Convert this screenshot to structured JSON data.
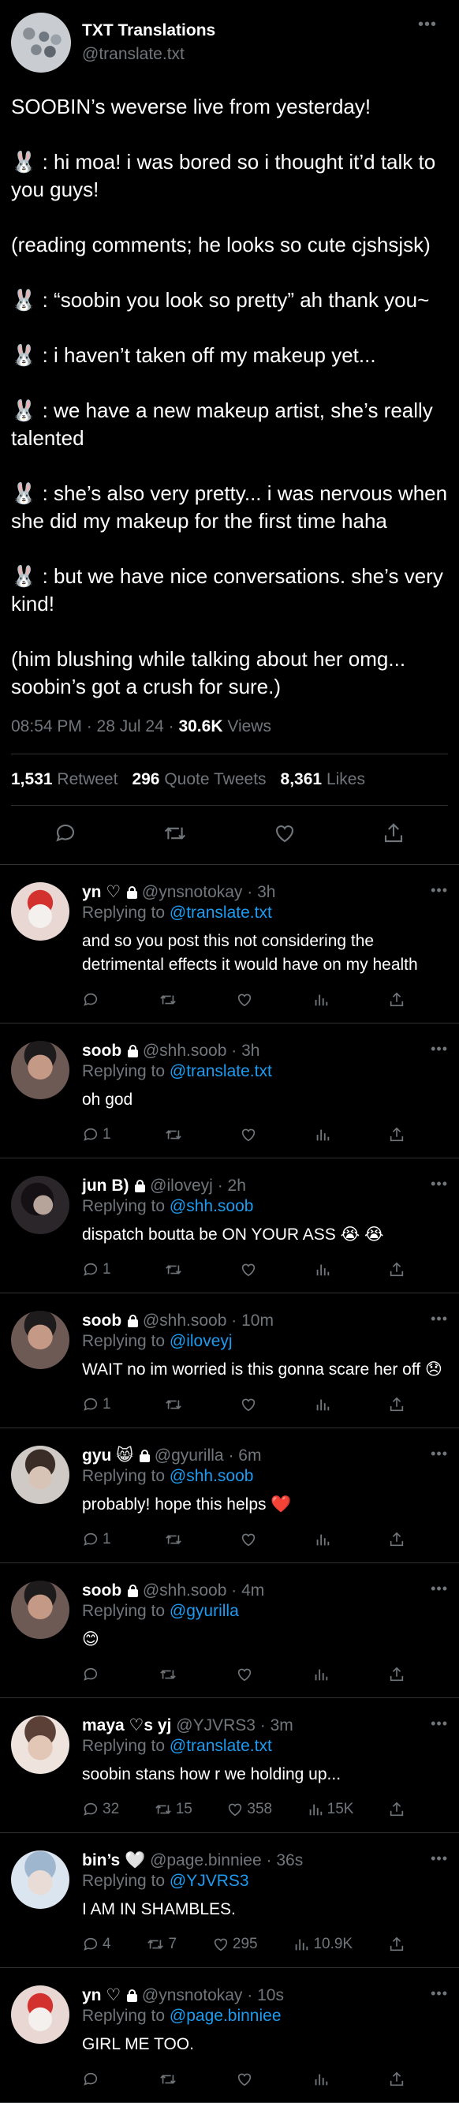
{
  "tweet": {
    "author_name": "TXT Translations",
    "author_handle": "@translate.txt",
    "paragraphs": [
      "SOOBIN’s weverse live from yesterday!",
      "🐰 : hi moa! i was bored so i thought it’d talk to you guys!",
      "(reading comments; he looks so cute cjshsjsk)",
      "🐰 : “soobin you look so pretty” ah thank you~",
      "🐰 : i haven’t taken off my makeup yet...",
      "🐰 : we have a new makeup artist, she’s really talented",
      "🐰 : she’s also very pretty... i was nervous when she did my makeup for the first time haha",
      "🐰 : but we have nice conversations. she’s very kind!",
      "(him blushing while talking about her omg... soobin’s got a crush for sure.)"
    ],
    "time": "08:54 PM · 28 Jul 24 · ",
    "views": "30.6K",
    "views_label": " Views",
    "retweets": "1,531",
    "retweets_label": "Retweet",
    "quotes": "296",
    "quotes_label": "Quote Tweets",
    "likes": "8,361",
    "likes_label": "Likes"
  },
  "replies": [
    {
      "name": "yn",
      "badges": "♡ ",
      "handle": "@ynsnotokay",
      "time": "· 3h",
      "replying_label": "Replying to ",
      "replying_to": "@translate.txt",
      "text": "and so you post this not considering the detrimental effects it would have on my health",
      "replies": "",
      "retweets": "",
      "likes": "",
      "views": ""
    },
    {
      "name": "soob",
      "badges": "",
      "handle": "@shh.soob",
      "time": "· 3h",
      "replying_label": "Replying to ",
      "replying_to": "@translate.txt",
      "text": "oh god",
      "replies": "1",
      "retweets": "",
      "likes": "",
      "views": ""
    },
    {
      "name": "jun B)",
      "badges": "",
      "handle": "@iloveyj",
      "time": "· 2h",
      "replying_label": "Replying to ",
      "replying_to": "@shh.soob",
      "text": "dispatch boutta be ON YOUR ASS 😭 😭",
      "replies": "1",
      "retweets": "",
      "likes": "",
      "views": ""
    },
    {
      "name": "soob",
      "badges": "",
      "handle": "@shh.soob",
      "time": "· 10m",
      "replying_label": "Replying to ",
      "replying_to": "@iloveyj",
      "text": "WAIT no im worried is this gonna scare her off 😞",
      "replies": "1",
      "retweets": "",
      "likes": "",
      "views": ""
    },
    {
      "name": "gyu",
      "badges": "😸 ",
      "handle": "@gyurilla",
      "time": "· 6m",
      "replying_label": "Replying to ",
      "replying_to": "@shh.soob",
      "text": "probably! hope this helps ❤️",
      "replies": "1",
      "retweets": "",
      "likes": "",
      "views": ""
    },
    {
      "name": "soob",
      "badges": "",
      "handle": "@shh.soob",
      "time": "· 4m",
      "replying_label": "Replying to ",
      "replying_to": "@gyurilla",
      "text": "😊",
      "replies": "",
      "retweets": "",
      "likes": "",
      "views": ""
    },
    {
      "name": "maya ♡s yj",
      "badges": "",
      "handle": "@YJVRS3",
      "time": "· 3m",
      "replying_label": "Replying to ",
      "replying_to": "@translate.txt",
      "text": "soobin stans how r we holding up...",
      "replies": "32",
      "retweets": "15",
      "likes": "358",
      "views": "15K"
    },
    {
      "name": "bin’s 🤍",
      "badges": "",
      "handle": "@page.binniee",
      "time": "· 36s",
      "replying_label": "Replying to ",
      "replying_to": "@YJVRS3",
      "text": "I AM IN SHAMBLES.",
      "replies": "4",
      "retweets": "7",
      "likes": "295",
      "views": "10.9K"
    },
    {
      "name": "yn",
      "badges": "♡ ",
      "handle": "@ynsnotokay",
      "time": "· 10s",
      "replying_label": "Replying to ",
      "replying_to": "@page.binniee",
      "text": "GIRL ME TOO.",
      "replies": "",
      "retweets": "",
      "likes": "",
      "views": ""
    }
  ],
  "icons": {
    "reply": "reply-icon",
    "retweet": "retweet-icon",
    "like": "heart-icon",
    "views": "views-icon",
    "share": "share-icon",
    "more": "more-icon",
    "lock": "lock-icon"
  },
  "colors": {
    "background": "#000000",
    "link": "#1d9bf0",
    "muted": "#71767b",
    "text": "#e7e9ea"
  }
}
